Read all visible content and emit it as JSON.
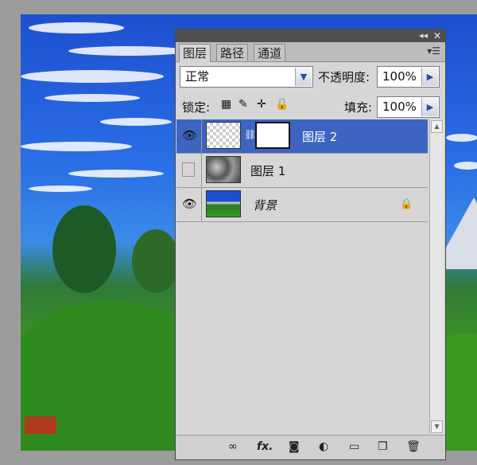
{
  "tabs": [
    "图层",
    "路径",
    "通道"
  ],
  "blend_mode": "正常",
  "opacity": {
    "label": "不透明度:",
    "value": "100%"
  },
  "fill": {
    "label": "填充:",
    "value": "100%"
  },
  "lock_label": "锁定:",
  "layers": [
    {
      "name": "图层 2",
      "visible": true,
      "selected": true,
      "thumb": "transparent",
      "has_mask": true
    },
    {
      "name": "图层 1",
      "visible": false,
      "selected": false,
      "thumb": "clouds"
    },
    {
      "name": "背景",
      "visible": true,
      "selected": false,
      "thumb": "landscape",
      "locked": true
    }
  ],
  "bottom_icons": [
    "link-icon",
    "fx-icon",
    "mask-icon",
    "adjustment-icon",
    "folder-icon",
    "new-layer-icon",
    "trash-icon"
  ],
  "bottom_fx": "fx.",
  "colors": {
    "selected": "#3c64c0",
    "panel": "#d6d6d6"
  }
}
